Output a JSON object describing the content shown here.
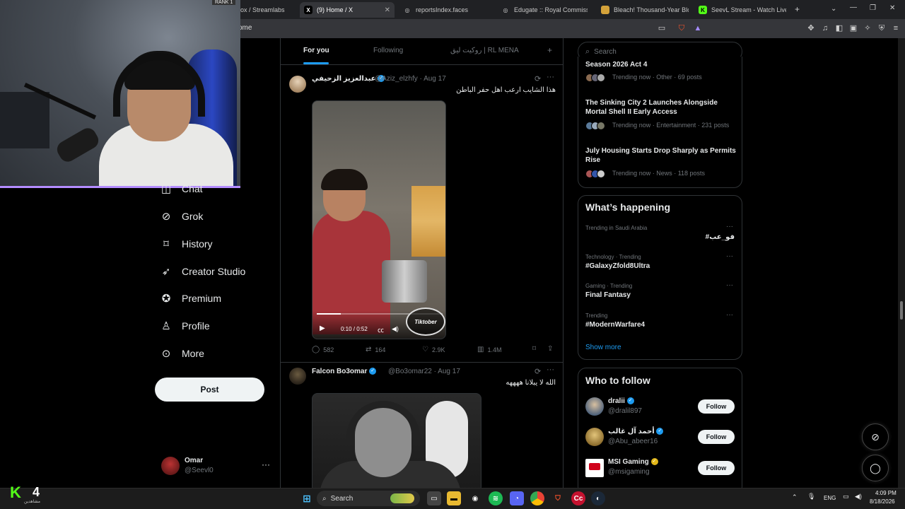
{
  "browser": {
    "tabs": [
      {
        "label": "ox / Streamlabs",
        "fav_color": "#31c3a2",
        "fav_glyph": ""
      },
      {
        "label": "(9) Home / X",
        "fav_color": "#000000",
        "fav_glyph": "X"
      },
      {
        "label": "reportsIndex.faces",
        "fav_color": "#444444",
        "fav_glyph": "◎"
      },
      {
        "label": "Edugate :: Royal Commission",
        "fav_color": "#444444",
        "fav_glyph": "◎"
      },
      {
        "label": "Bleach! Thousand-Year Blood",
        "fav_color": "#d4a23a",
        "fav_glyph": ""
      },
      {
        "label": "SeevL Stream - Watch Live on",
        "fav_color": "#53fc18",
        "fav_glyph": "K"
      }
    ],
    "new_tab": "+",
    "url": "ome"
  },
  "webcam": {
    "rank_label": "RANK 1"
  },
  "nav": {
    "items": [
      {
        "label": "Chat",
        "icon": "chat-icon",
        "glyph": "◫"
      },
      {
        "label": "Grok",
        "icon": "grok-icon",
        "glyph": "⊘"
      },
      {
        "label": "History",
        "icon": "bookmark-icon",
        "glyph": "⌑"
      },
      {
        "label": "Creator Studio",
        "icon": "rocket-icon",
        "glyph": "➶"
      },
      {
        "label": "Premium",
        "icon": "verified-badge-icon",
        "glyph": "✪"
      },
      {
        "label": "Profile",
        "icon": "person-icon",
        "glyph": "♙"
      },
      {
        "label": "More",
        "icon": "more-circle-icon",
        "glyph": "⊙"
      }
    ],
    "post_label": "Post",
    "account": {
      "name": "Omar",
      "handle": "@Seevl0",
      "more": "···"
    }
  },
  "feed": {
    "tabs": [
      "For you",
      "Following",
      "روكيت ليق | RL MENA"
    ],
    "add_tab": "+",
    "tweets": [
      {
        "name": "عبدالعزيز الزحيفي",
        "meta": "@Aziz_elzhfy · Aug 17",
        "text": "هذا الشايب ارعب اهل حفر الباطن",
        "video_time": "0:10 / 0:52",
        "video_progress": 0.19,
        "watermark": "Tiktober",
        "actions": {
          "replies": "582",
          "reposts": "164",
          "likes": "2.9K",
          "views": "1.4M"
        }
      },
      {
        "name": "Falcon Bo3omar",
        "meta": "@Bo3omar22 · Aug 17",
        "text": "الله لا يبلانا ههههه"
      }
    ]
  },
  "right": {
    "search_placeholder": "Search",
    "news": [
      {
        "title": "Season 2026 Act 4",
        "meta": "Trending now · Other · 69 posts"
      },
      {
        "title": "The Sinking City 2 Launches Alongside Mortal Shell II Early Access",
        "meta": "Trending now · Entertainment · 231 posts"
      },
      {
        "title": "July Housing Starts Drop Sharply as Permits Rise",
        "meta": "Trending now · News · 118 posts"
      }
    ],
    "whats_happening": {
      "title": "What’s happening",
      "trends": [
        {
          "cat": "Trending in Saudi Arabia",
          "name": "#فو_عب"
        },
        {
          "cat": "Technology · Trending",
          "name": "#GalaxyZfold8Ultra"
        },
        {
          "cat": "Gaming · Trending",
          "name": "Final Fantasy"
        },
        {
          "cat": "Trending",
          "name": "#ModernWarfare4"
        }
      ],
      "show_more": "Show more"
    },
    "who_to_follow": {
      "title": "Who to follow",
      "accounts": [
        {
          "name": "dralii",
          "handle": "@dralil897",
          "follow": "Follow"
        },
        {
          "name": "أحمد آل غالب",
          "handle": "@Abu_abeer16",
          "follow": "Follow"
        },
        {
          "name": "MSI Gaming",
          "handle": "@msigaming",
          "follow": "Follow"
        }
      ]
    }
  },
  "taskbar": {
    "search": "Search",
    "lang": "ENG",
    "time": "4:09 PM",
    "date": "8/18/2026",
    "kick_count": "4",
    "kick_label": "مشاهدين"
  }
}
